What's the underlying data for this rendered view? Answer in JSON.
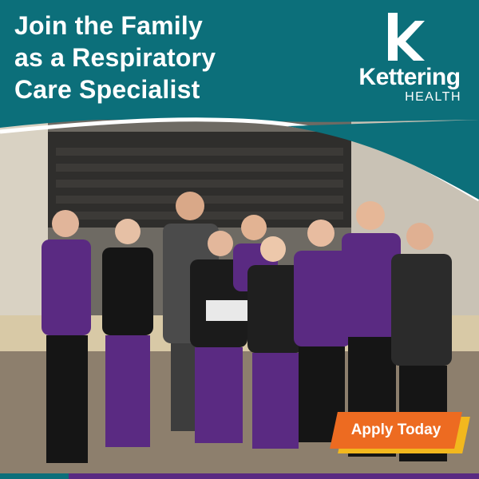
{
  "ad": {
    "headline": {
      "line1": "Join the Family",
      "line2": "as a Respiratory",
      "line3": "Care Specialist"
    },
    "logo": {
      "brand": "Kettering",
      "sub": "HEALTH"
    },
    "cta": {
      "label": "Apply Today"
    },
    "photo_description_icon": "group-photo"
  },
  "colors": {
    "teal": "#0c6f7a",
    "white": "#ffffff",
    "orange": "#ed6b21",
    "yellow": "#f2b81e",
    "purple": "#5a2a82"
  }
}
